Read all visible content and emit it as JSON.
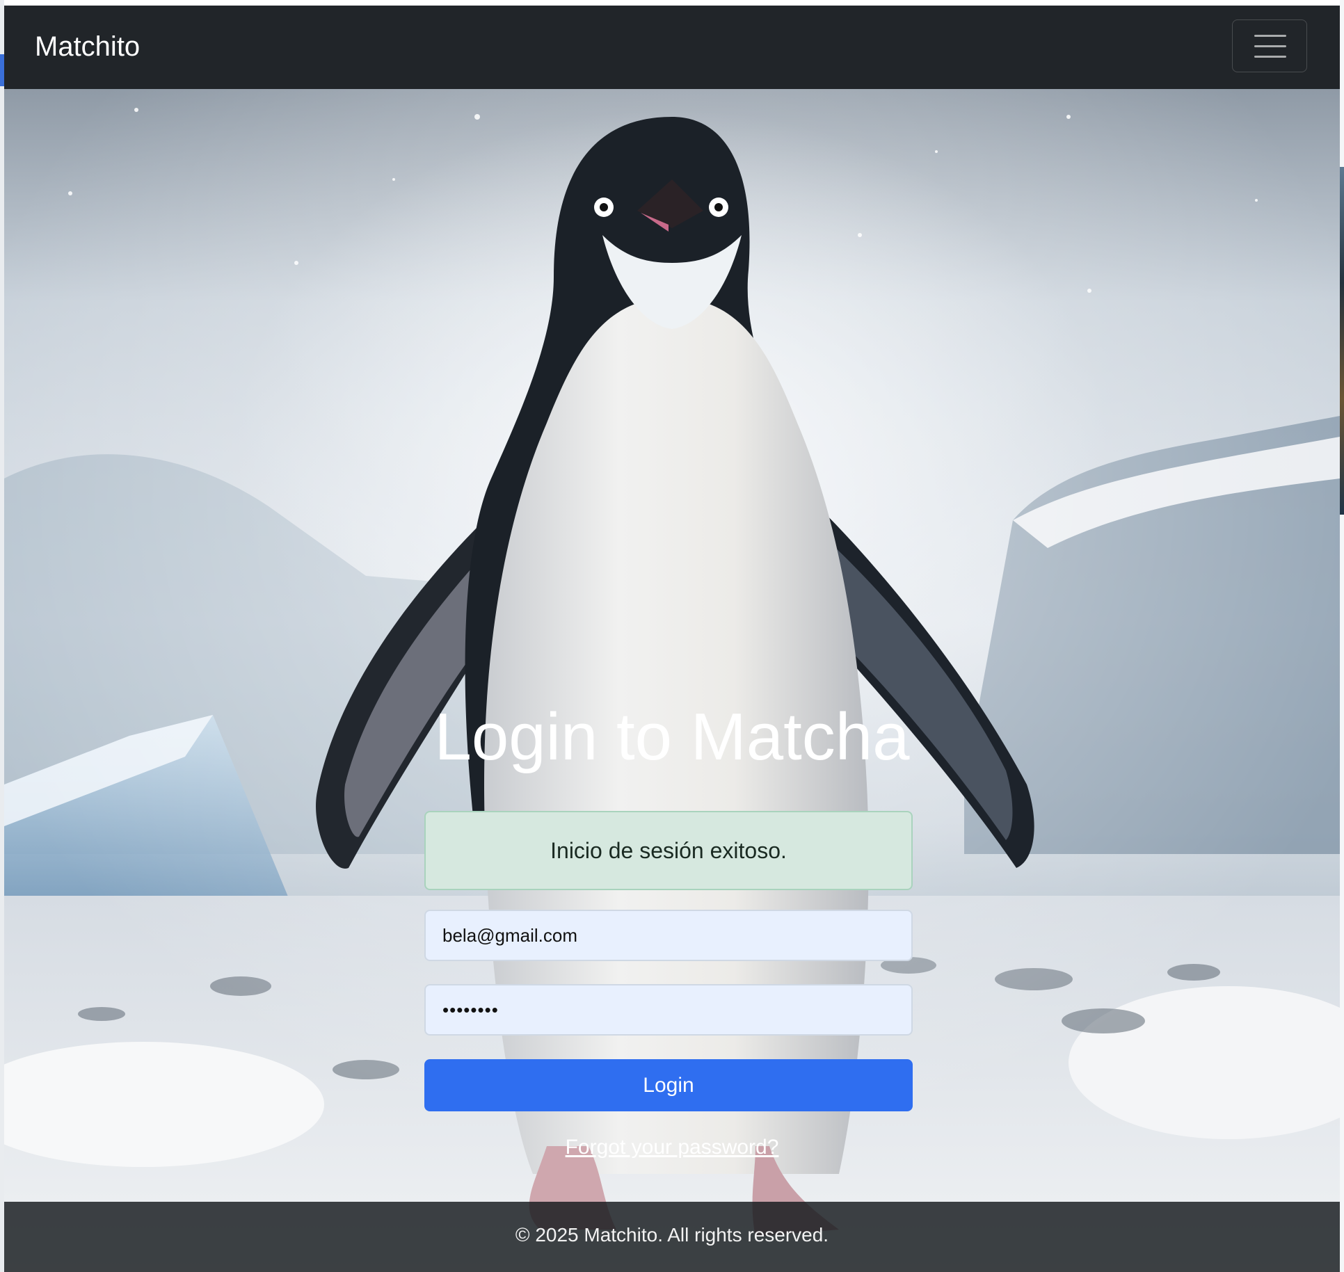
{
  "navbar": {
    "brand": "Matchito",
    "toggle_icon": "hamburger-menu-icon"
  },
  "hero": {
    "background_image": "penguin-in-snow",
    "title": "Login to Matcha"
  },
  "login_form": {
    "alert_message": "Inicio de sesión exitoso.",
    "email_value": "bela@gmail.com",
    "password_value": "••••••••",
    "login_button_label": "Login",
    "forgot_password_label": "Forgot your password?"
  },
  "footer": {
    "text": "© 2025 Matchito. All rights reserved."
  },
  "colors": {
    "navbar_bg": "#212529",
    "login_button": "#2f6ef0",
    "alert_bg": "#d6e8df",
    "alert_border": "#a9d3bd",
    "input_bg": "#e8f0fe"
  }
}
